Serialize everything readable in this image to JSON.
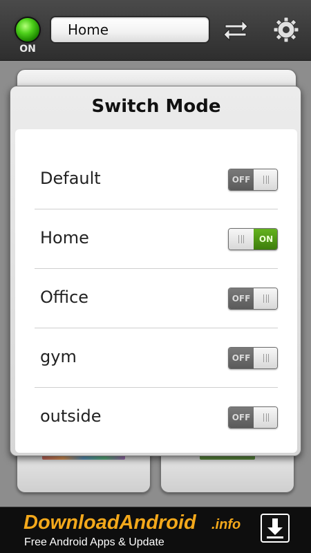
{
  "topbar": {
    "power_status": "ON",
    "current_mode": "Home",
    "icons": [
      "power-indicator",
      "swap-arrows-icon",
      "gear-icon"
    ]
  },
  "dialog": {
    "title": "Switch Mode",
    "modes": [
      {
        "name": "Default",
        "state": "OFF",
        "on": false
      },
      {
        "name": "Home",
        "state": "ON",
        "on": true
      },
      {
        "name": "Office",
        "state": "OFF",
        "on": false
      },
      {
        "name": "gym",
        "state": "OFF",
        "on": false
      },
      {
        "name": "outside",
        "state": "OFF",
        "on": false
      }
    ]
  },
  "ad": {
    "brand": "DownloadAndroid",
    "domain": ".info",
    "tagline": "Free Android Apps & Update",
    "icon": "download-icon"
  },
  "colors": {
    "accent_orange": "#f3a81b",
    "toggle_on_green": "#4f9a15",
    "power_green": "#4fd11c"
  }
}
